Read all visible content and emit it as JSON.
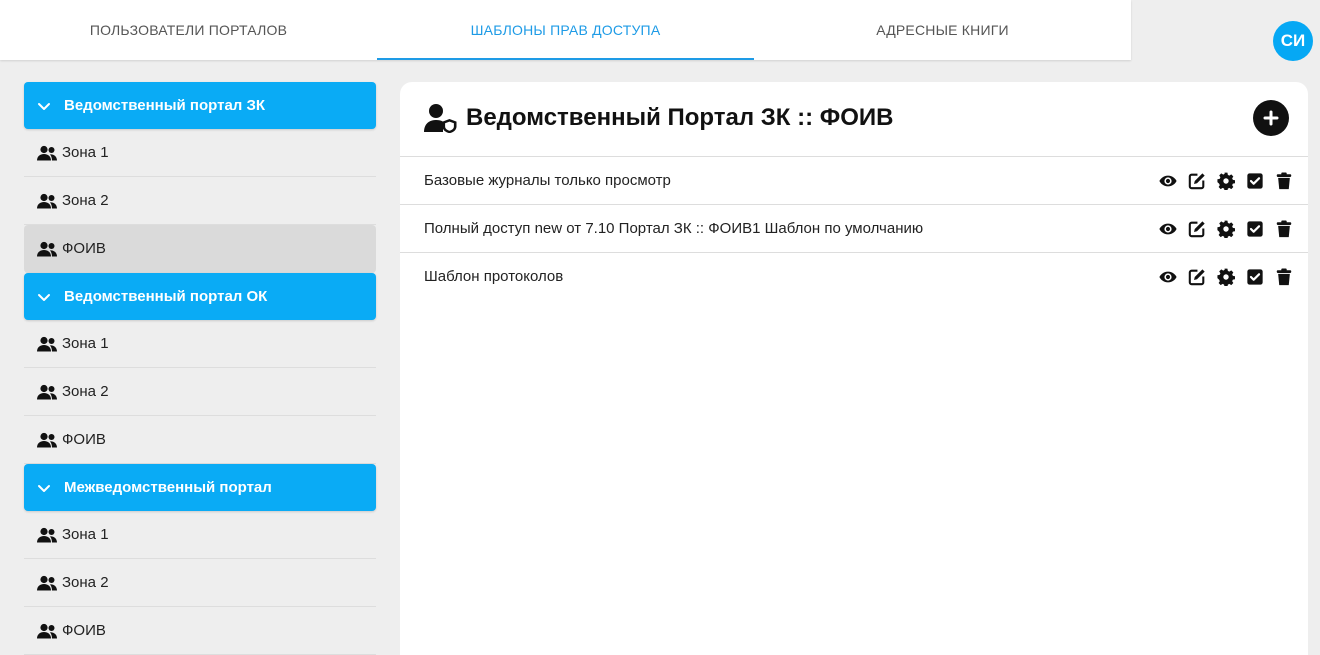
{
  "tabs": [
    {
      "label": "ПОЛЬЗОВАТЕЛИ ПОРТАЛОВ",
      "active": false
    },
    {
      "label": "ШАБЛОНЫ ПРАВ ДОСТУПА",
      "active": true
    },
    {
      "label": "АДРЕСНЫЕ КНИГИ",
      "active": false
    }
  ],
  "user": {
    "initials": "СИ"
  },
  "colors": {
    "accent": "#0aabf5",
    "tab_active": "#1e9be6",
    "selected_row": "#dadada"
  },
  "sidebar": {
    "groups": [
      {
        "title": "Ведомственный портал ЗК",
        "icon": "chevron-down-icon",
        "zones": [
          {
            "label": "Зона 1",
            "icon": "users-icon"
          },
          {
            "label": "Зона 2",
            "icon": "users-icon"
          },
          {
            "label": "ФОИВ",
            "icon": "users-icon",
            "selected": true
          }
        ]
      },
      {
        "title": "Ведомственный портал ОК",
        "icon": "chevron-down-icon",
        "zones": [
          {
            "label": "Зона 1",
            "icon": "users-icon"
          },
          {
            "label": "Зона 2",
            "icon": "users-icon"
          },
          {
            "label": "ФОИВ",
            "icon": "users-icon"
          }
        ]
      },
      {
        "title": "Межведомственный портал",
        "icon": "chevron-down-icon",
        "zones": [
          {
            "label": "Зона 1",
            "icon": "users-icon"
          },
          {
            "label": "Зона 2",
            "icon": "users-icon"
          },
          {
            "label": "ФОИВ",
            "icon": "users-icon"
          }
        ]
      }
    ]
  },
  "main": {
    "title": "Ведомственный Портал ЗК :: ФОИВ",
    "title_icon": "user-shield-icon",
    "add_icon": "plus-circle-icon",
    "templates": [
      {
        "label": "Базовые журналы только просмотр"
      },
      {
        "label": "Полный доступ new от 7.10 Портал ЗК :: ФОИВ1  Шаблон по умолчанию"
      },
      {
        "label": "Шаблон протоколов"
      }
    ],
    "row_actions": [
      "eye-icon",
      "edit-icon",
      "gear-icon",
      "checkbox-icon",
      "trash-icon"
    ]
  }
}
